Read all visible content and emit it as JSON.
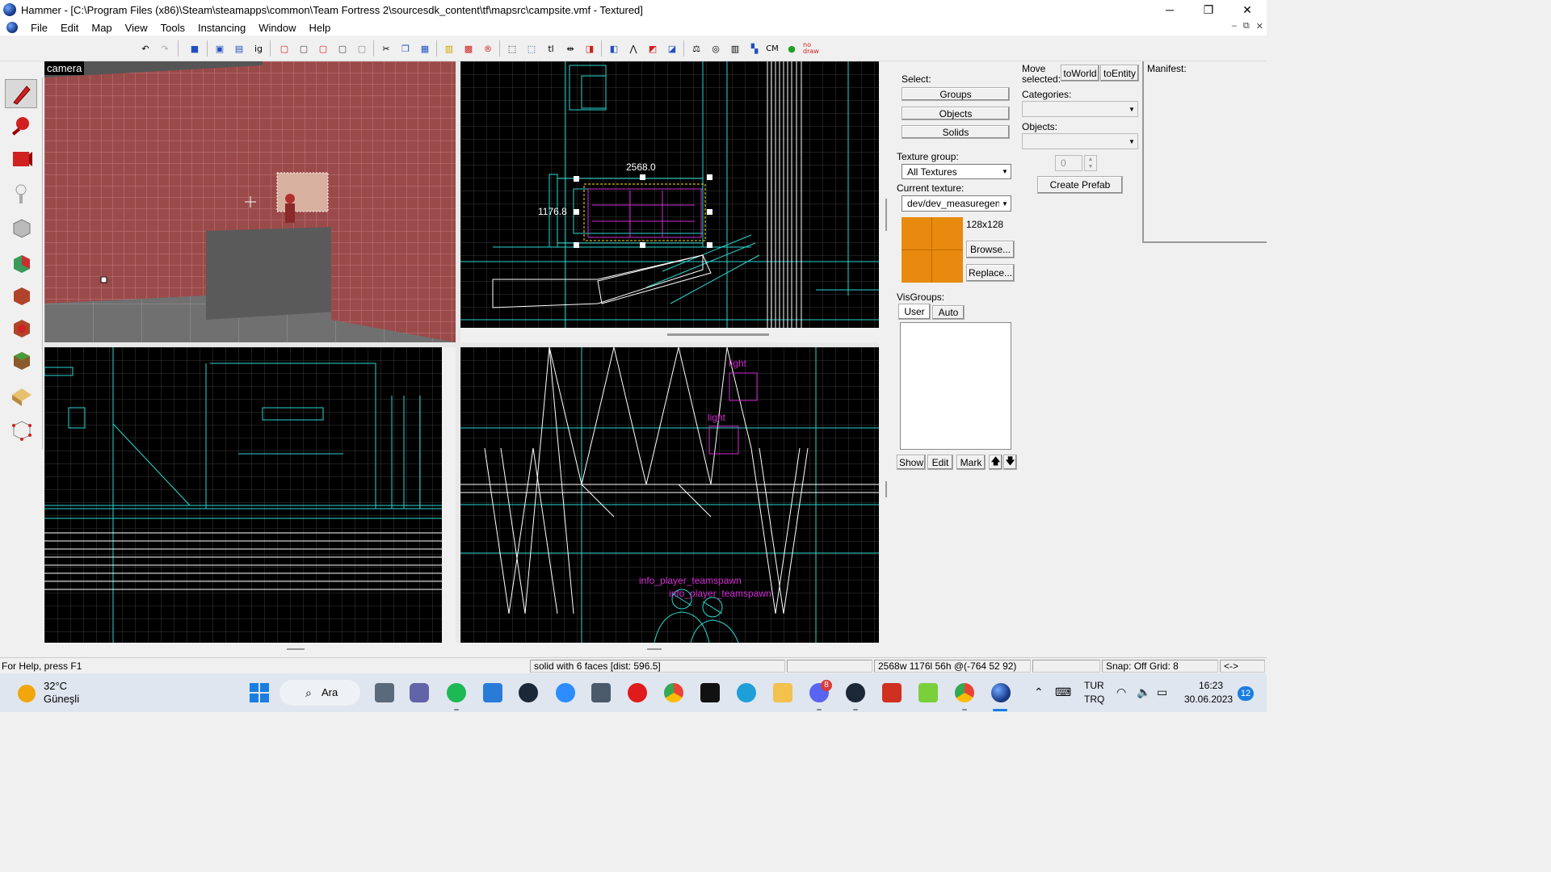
{
  "window": {
    "title": "Hammer - [C:\\Program Files (x86)\\Steam\\steamapps\\common\\Team Fortress 2\\sourcesdk_content\\tf\\mapsrc\\campsite.vmf - Textured]",
    "minimize": "─",
    "restore": "❐",
    "close": "✕"
  },
  "menu": [
    "File",
    "Edit",
    "Map",
    "View",
    "Tools",
    "Instancing",
    "Window",
    "Help"
  ],
  "mdi_controls": {
    "min": "–",
    "restore": "⧉",
    "close": "✕"
  },
  "toolbar_text": {
    "ig": "ig",
    "tl": "tl",
    "cm": "CM",
    "nodraw": "no draw"
  },
  "viewports": {
    "camera": {
      "label": "camera"
    },
    "top": {
      "dim_width": "2568.0",
      "dim_height": "1176.8"
    },
    "side": {
      "entities": [
        "light",
        "light",
        "info_player_teamspawn",
        "info_player_teamspawn"
      ]
    }
  },
  "selection_panel": {
    "select_label": "Select:",
    "buttons": [
      "Groups",
      "Objects",
      "Solids"
    ],
    "texture_group_label": "Texture group:",
    "texture_group_value": "All Textures",
    "current_texture_label": "Current texture:",
    "current_texture_value": "dev/dev_measuregene",
    "texture_size": "128x128",
    "texture_color": "#e88a0e",
    "browse_button": "Browse...",
    "replace_button": "Replace...",
    "visgroups_label": "VisGroups:",
    "visgroup_tabs": [
      "User",
      "Auto"
    ],
    "visgroup_buttons": [
      "Show",
      "Edit",
      "Mark"
    ]
  },
  "move_panel": {
    "move_label_1": "Move",
    "move_label_2": "selected:",
    "to_world": "toWorld",
    "to_entity": "toEntity",
    "categories_label": "Categories:",
    "objects_label": "Objects:",
    "spin_value": "0",
    "create_prefab": "Create Prefab"
  },
  "manifest": {
    "label": "Manifest:"
  },
  "statusbar": {
    "help": "For Help, press F1",
    "selection": "solid with 6 faces  [dist: 596.5]",
    "size": "2568w 1176l 56h @(-764 52 92)",
    "snap": "Snap: Off Grid: 8",
    "arrows": "<->"
  },
  "taskbar": {
    "weather_temp": "32°C",
    "weather_desc": "Güneşli",
    "search": "Ara",
    "lang_1": "TUR",
    "lang_2": "TRQ",
    "time": "16:23",
    "date": "30.06.2023",
    "notif_count": "12",
    "discord_badge": "8"
  },
  "colors": {
    "wall": "#9b4a4a",
    "grid": "#3a3a3a",
    "cyan": "#2ad6cf",
    "magenta": "#d02bd0"
  }
}
